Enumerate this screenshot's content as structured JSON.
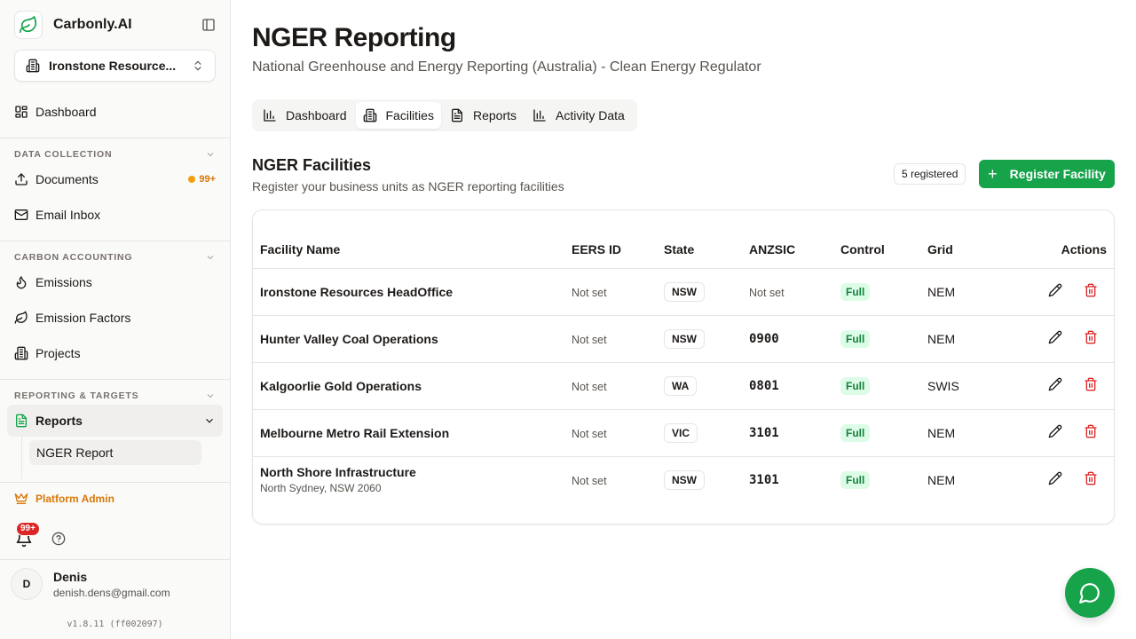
{
  "brand": {
    "name": "Carbonly.AI"
  },
  "org": {
    "name": "Ironstone Resource..."
  },
  "sidebar": {
    "dashboard": "Dashboard",
    "sections": [
      {
        "label": "DATA COLLECTION"
      },
      {
        "label": "CARBON ACCOUNTING"
      },
      {
        "label": "REPORTING & TARGETS"
      }
    ],
    "documents": {
      "label": "Documents",
      "badge": "99+"
    },
    "email_inbox": "Email Inbox",
    "emissions": "Emissions",
    "emission_factors": "Emission Factors",
    "projects": "Projects",
    "reports": "Reports",
    "nger_report": "NGER Report",
    "platform_admin": "Platform Admin",
    "notifications_badge": "99+"
  },
  "user": {
    "initial": "D",
    "name": "Denis",
    "email": "denish.dens@gmail.com"
  },
  "version": "v1.8.11 (ff002097)",
  "page": {
    "title": "NGER Reporting",
    "subtitle": "National Greenhouse and Energy Reporting (Australia) - Clean Energy Regulator"
  },
  "tabs": [
    {
      "label": "Dashboard",
      "icon": "bar-chart-icon"
    },
    {
      "label": "Facilities",
      "icon": "building-icon",
      "active": true
    },
    {
      "label": "Reports",
      "icon": "document-icon"
    },
    {
      "label": "Activity Data",
      "icon": "bar-chart-icon"
    }
  ],
  "facilities": {
    "title": "NGER Facilities",
    "description": "Register your business units as NGER reporting facilities",
    "count_badge": "5 registered",
    "register_label": "Register Facility",
    "columns": [
      "Facility Name",
      "EERS ID",
      "State",
      "ANZSIC",
      "Control",
      "Grid",
      "Actions"
    ],
    "rows": [
      {
        "name": "Ironstone Resources HeadOffice",
        "sub": "",
        "eers": "Not set",
        "state": "NSW",
        "anzsic": "Not set",
        "control": "Full",
        "grid": "NEM"
      },
      {
        "name": "Hunter Valley Coal Operations",
        "sub": "",
        "eers": "Not set",
        "state": "NSW",
        "anzsic": "0900",
        "control": "Full",
        "grid": "NEM"
      },
      {
        "name": "Kalgoorlie Gold Operations",
        "sub": "",
        "eers": "Not set",
        "state": "WA",
        "anzsic": "0801",
        "control": "Full",
        "grid": "SWIS"
      },
      {
        "name": "Melbourne Metro Rail Extension",
        "sub": "",
        "eers": "Not set",
        "state": "VIC",
        "anzsic": "3101",
        "control": "Full",
        "grid": "NEM"
      },
      {
        "name": "North Shore Infrastructure",
        "sub": "North Sydney, NSW 2060",
        "eers": "Not set",
        "state": "NSW",
        "anzsic": "3101",
        "control": "Full",
        "grid": "NEM"
      }
    ]
  },
  "colors": {
    "accent": "#16a34a",
    "danger": "#dc2626",
    "warning": "#d97706"
  }
}
